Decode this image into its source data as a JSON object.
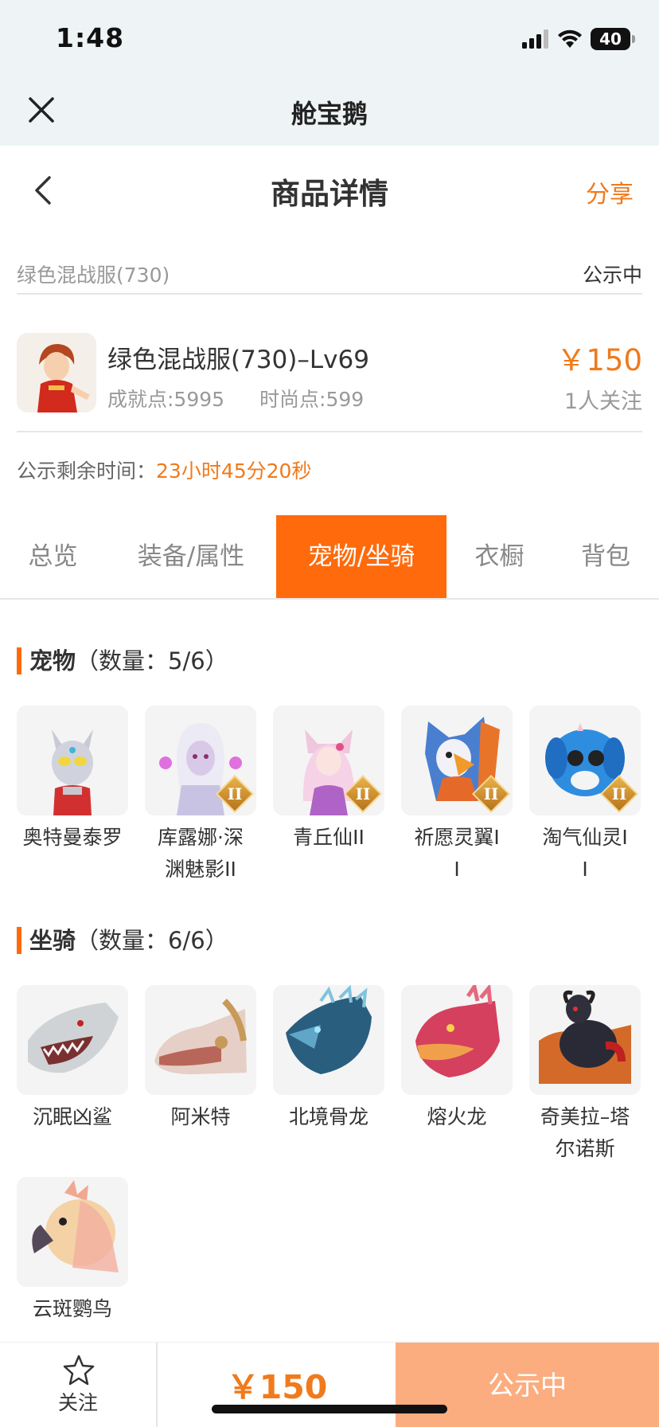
{
  "status_bar": {
    "time": "1:48",
    "battery": "40"
  },
  "miniapp": {
    "title": "舱宝鹅"
  },
  "header": {
    "title": "商品详情",
    "share_label": "分享"
  },
  "crumb": {
    "text": "绿色混战服(730)",
    "status": "公示中"
  },
  "product": {
    "name": "绿色混战服(730)–Lv69",
    "achievement": "成就点:5995",
    "fashion": "时尚点:599",
    "price": "￥150",
    "followers": "1人关注"
  },
  "remaining": {
    "label": "公示剩余时间：",
    "value": "23小时45分20秒"
  },
  "tabs": [
    {
      "label": "总览",
      "active": false
    },
    {
      "label": "装备/属性",
      "active": false
    },
    {
      "label": "宠物/坐骑",
      "active": true
    },
    {
      "label": "衣橱",
      "active": false
    },
    {
      "label": "背包",
      "active": false
    }
  ],
  "pets": {
    "title": "宠物",
    "count": "（数量：5/6）",
    "items": [
      {
        "name": "奥特曼泰罗",
        "badge": "",
        "icon": "ultraman-icon"
      },
      {
        "name": "库露娜·深渊魅影II",
        "badge": "II",
        "icon": "ghost-girl-icon"
      },
      {
        "name": "青丘仙II",
        "badge": "II",
        "icon": "fox-fairy-icon"
      },
      {
        "name": "祈愿灵翼II",
        "badge": "II",
        "icon": "eagle-icon"
      },
      {
        "name": "淘气仙灵II",
        "badge": "II",
        "icon": "blue-puppy-icon"
      }
    ]
  },
  "mounts": {
    "title": "坐骑",
    "count": "（数量：6/6）",
    "items": [
      {
        "name": "沉眠凶鲨",
        "icon": "shark-icon"
      },
      {
        "name": "阿米特",
        "icon": "crocodile-icon"
      },
      {
        "name": "北境骨龙",
        "icon": "bone-dragon-icon"
      },
      {
        "name": "熔火龙",
        "icon": "fire-dragon-icon"
      },
      {
        "name": "奇美拉–塔尔诺斯",
        "icon": "chimera-icon"
      },
      {
        "name": "云斑鹦鸟",
        "icon": "parrot-icon"
      }
    ]
  },
  "bottom_bar": {
    "follow_label": "关注",
    "price": "￥150",
    "action_label": "公示中"
  },
  "colors": {
    "accent": "#ff6a0c",
    "price": "#f07a1c",
    "cta": "#fcad80"
  }
}
